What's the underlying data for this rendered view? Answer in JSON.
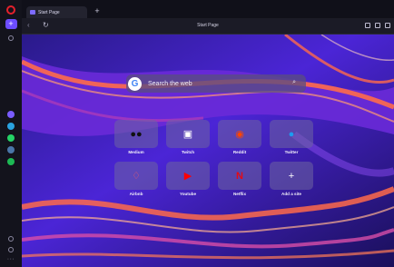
{
  "tabs": [
    {
      "title": "Start Page"
    }
  ],
  "new_tab_label": "+",
  "address": {
    "url": "Start Page"
  },
  "search": {
    "placeholder": "Search the web",
    "engine_glyph": "G"
  },
  "speed_dial": [
    {
      "label": "Medium",
      "icon": "medium-icon",
      "glyph": "●●",
      "color": "#111111"
    },
    {
      "label": "Twitch",
      "icon": "twitch-icon",
      "glyph": "▣",
      "color": "#1c1c1c"
    },
    {
      "label": "Reddit",
      "icon": "reddit-icon",
      "glyph": "◉",
      "color": "#ff4500"
    },
    {
      "label": "Twitter",
      "icon": "twitter-icon",
      "glyph": "●",
      "color": "#1d9bf0"
    },
    {
      "label": "Airbnb",
      "icon": "airbnb-icon",
      "glyph": "♢",
      "color": "#ff5a5f"
    },
    {
      "label": "Youtube",
      "icon": "youtube-icon",
      "glyph": "▶",
      "color": "#ff0000"
    },
    {
      "label": "Netflix",
      "icon": "netflix-icon",
      "glyph": "N",
      "color": "#e50914"
    },
    {
      "label": "Add a site",
      "icon": "plus-icon",
      "glyph": "+",
      "color": "#ffffff"
    }
  ],
  "sidebar": {
    "apps": [
      {
        "name": "messenger-icon",
        "color": "#7a5cff"
      },
      {
        "name": "telegram-icon",
        "color": "#2aa3e0"
      },
      {
        "name": "whatsapp-icon",
        "color": "#25d366"
      },
      {
        "name": "vk-icon",
        "color": "#4a76a8"
      },
      {
        "name": "spotify-icon",
        "color": "#1db954"
      }
    ]
  },
  "colors": {
    "accent": "#6d4dff",
    "opera_red": "#e5212c"
  }
}
